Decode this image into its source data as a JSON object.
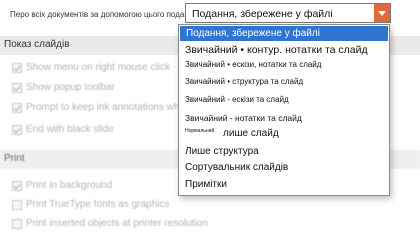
{
  "header": {
    "label": "Перо всіх документів за допомогою цього подання",
    "select_value": "Подання, збережене у файлі"
  },
  "sections": {
    "slide_show": "Показ слайдів",
    "print": "Print"
  },
  "slide_show_options": [
    {
      "label": "Show menu on right mouse click",
      "checked": true
    },
    {
      "label": "Show popup toolbar",
      "checked": true
    },
    {
      "label": "Prompt to keep ink annotations when exiting",
      "checked": true
    },
    {
      "label": "End with black slide",
      "checked": true
    }
  ],
  "print_options": [
    {
      "label": "Print in background",
      "checked": true
    },
    {
      "label": "Print TrueType fonts as graphics",
      "checked": false
    },
    {
      "label": "Print inserted objects at printer resolution",
      "checked": false
    }
  ],
  "dropdown": {
    "selected": "Подання, збережене у файлі",
    "items": {
      "normal_outline": "Звичайний • контур. нотатки та слайд",
      "normal_thumbs_notes": "Звичайний • ескізи, нотатки та слайд",
      "normal_structure": "Звичайний • структура та слайд",
      "normal_thumbs_slide": "Звичайний - ескізи та слайд",
      "normal_notes_slide": "Звичайний - нотатки та слайд",
      "normal_prefix": "Нормальний",
      "slide_only": "лише слайд",
      "outline_only": "Лише структура",
      "slide_sorter": "Сортувальник слайдів",
      "notes": "Примітки"
    }
  },
  "colors": {
    "accent_orange": "#e06a3b",
    "selection_blue": "#2f74cf",
    "section_bg": "#eaeaea"
  },
  "icons": {
    "dropdown_arrow": "chevron-down-icon"
  }
}
